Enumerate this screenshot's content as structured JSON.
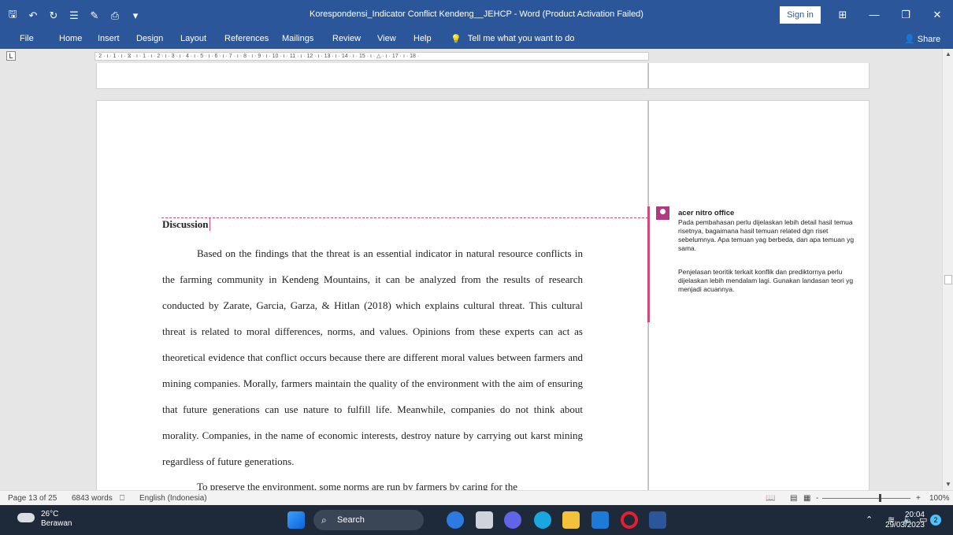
{
  "window": {
    "title": "Korespondensi_Indicator Conflict Kendeng__JEHCP  -  Word (Product Activation Failed)",
    "sign_in": "Sign in"
  },
  "menu": {
    "tabs": [
      "File",
      "Home",
      "Insert",
      "Design",
      "Layout",
      "References",
      "Mailings",
      "Review",
      "View",
      "Help"
    ],
    "tell_me": "Tell me what you want to do",
    "share": "Share"
  },
  "ruler": {
    "text": "· 2 · ı · 1 · ı · ⧖ · ı · 1 · ı · 2 · ı · 3 · ı · 4 · ı · 5 · ı · 6 · ı · 7 · ı · 8 · ı · 9 · ı · 10 · ı · 11 · ı · 12 · ı · 13 · ı · 14 · ı · 15 · ı · △ · ı · 17 · ı · 18 ·"
  },
  "document": {
    "heading": "Discussion",
    "paragraph1": "Based on the findings that the threat is an essential indicator in natural resource conflicts in the farming community in Kendeng Mountains, it can be analyzed from the results of research conducted by Zarate, Garcia, Garza, & Hitlan (2018) which explains cultural threat. This cultural threat is related to moral differences, norms, and values. Opinions from these experts can act as theoretical evidence that conflict occurs because there are different moral values between farmers and mining companies. Morally, farmers maintain the quality of the environment with the aim of ensuring that future generations can use nature to fulfill life. Meanwhile, companies do not think about morality. Companies, in the name of economic interests, destroy nature by carrying out karst mining regardless of future generations.",
    "paragraph2": "To preserve the environment, some norms are run by farmers by caring for the"
  },
  "comment": {
    "author": "acer nitro office",
    "text1": "Pada pembahasan perlu dijelaskan lebih detail hasil temua risetnya, bagaimana hasil temuan related dgn riset sebelumnya. Apa temuan yag berbeda, dan apa temuan yg sama.",
    "text2": "Penjelasan teoritik terkait konflik dan prediktornya perlu dijelaskan lebih mendalam lagi. Gunakan landasan teori yg menjadi acuannya."
  },
  "status": {
    "page": "Page 13 of 25",
    "words": "6843 words",
    "language": "English (Indonesia)",
    "zoom": "100%",
    "zoom_minus": "-",
    "zoom_plus": "+"
  },
  "taskbar": {
    "temperature": "26°C",
    "weather": "Berawan",
    "search": "Search",
    "time": "20:04",
    "date": "29/03/2023",
    "notifications": "2"
  },
  "colors": {
    "word_blue": "#2b579a",
    "comment_accent": "#d04a7a",
    "taskbar": "#1e2a3a"
  }
}
